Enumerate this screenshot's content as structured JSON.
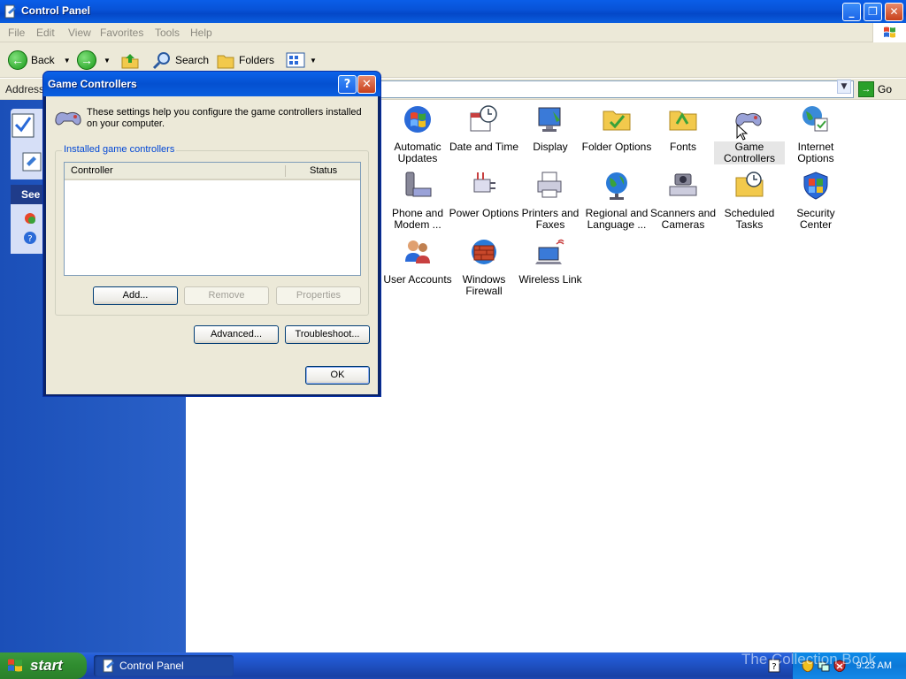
{
  "window": {
    "title": "Control Panel"
  },
  "menu": [
    "File",
    "Edit",
    "View",
    "Favorites",
    "Tools",
    "Help"
  ],
  "toolbar": {
    "back_label": "Back",
    "search_label": "Search",
    "folders_label": "Folders"
  },
  "address": {
    "label": "Address",
    "value": "",
    "go_label": "Go"
  },
  "sidebar": {
    "see_also_header": "See"
  },
  "control_panel": {
    "items": [
      {
        "label": "Automatic Updates",
        "icon": "automatic-updates-icon"
      },
      {
        "label": "Date and Time",
        "icon": "date-time-icon"
      },
      {
        "label": "Display",
        "icon": "display-icon"
      },
      {
        "label": "Folder Options",
        "icon": "folder-options-icon"
      },
      {
        "label": "Fonts",
        "icon": "fonts-icon"
      },
      {
        "label": "Game Controllers",
        "icon": "game-controllers-icon"
      },
      {
        "label": "Internet Options",
        "icon": "internet-options-icon"
      },
      {
        "label": "Phone and Modem ...",
        "icon": "phone-modem-icon"
      },
      {
        "label": "Power Options",
        "icon": "power-options-icon"
      },
      {
        "label": "Printers and Faxes",
        "icon": "printers-faxes-icon"
      },
      {
        "label": "Regional and Language ...",
        "icon": "regional-language-icon"
      },
      {
        "label": "Scanners and Cameras",
        "icon": "scanners-cameras-icon"
      },
      {
        "label": "Scheduled Tasks",
        "icon": "scheduled-tasks-icon"
      },
      {
        "label": "Security Center",
        "icon": "security-center-icon"
      },
      {
        "label": "User Accounts",
        "icon": "user-accounts-icon"
      },
      {
        "label": "Windows Firewall",
        "icon": "windows-firewall-icon"
      },
      {
        "label": "Wireless Link",
        "icon": "wireless-link-icon"
      }
    ]
  },
  "dialog": {
    "title": "Game Controllers",
    "intro": "These settings help you configure the game controllers installed on your computer.",
    "group_label": "Installed game controllers",
    "columns": [
      "Controller",
      "Status"
    ],
    "rows": [],
    "buttons": {
      "add": "Add...",
      "remove": "Remove",
      "properties": "Properties",
      "advanced": "Advanced...",
      "troubleshoot": "Troubleshoot...",
      "ok": "OK"
    }
  },
  "taskbar": {
    "start_label": "start",
    "task_label": "Control Panel",
    "clock": "9:23 AM",
    "watermark": "The Collection Book"
  },
  "colors": {
    "titlebar": "#0a5ee8",
    "sidebar": "#1b4fb8",
    "dialog_face": "#ece9d8",
    "taskbar": "#245edb",
    "start_green": "#2f8c2f"
  }
}
